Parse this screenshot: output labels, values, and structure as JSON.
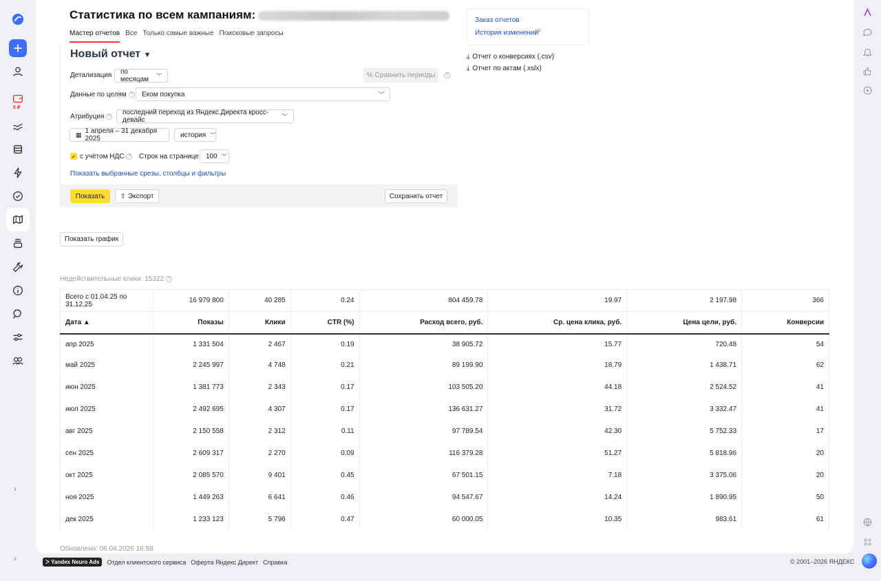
{
  "title": "Статистика по всем кампаниям:",
  "tabs": [
    "Мастер отчетов",
    "Все",
    "Только самые важные",
    "Поисковые запросы"
  ],
  "report": {
    "name": "Новый отчет",
    "detail_label": "Детализация",
    "detail_value": "по месяцам",
    "compare_label": "Сравнить периоды",
    "goals_label": "Данные по целям",
    "goals_value": "Еком покупка",
    "attribution_label": "Атрибуция",
    "attribution_value": "последний переход из Яндекс.Директа кросс-девайс",
    "date_range": "1 апреля – 31 декабря 2025",
    "history_value": "история",
    "vat_label": "с учётом НДС",
    "rows_label": "Строк на странице",
    "rows_value": "100",
    "filters_link": "Показать выбранные срезы, столбцы и фильтры",
    "show_button": "Показать",
    "export_button": "Экспорт",
    "save_button": "Сохранить отчет"
  },
  "side": {
    "order_reports": "Заказ отчетов",
    "change_history": "История изменений",
    "conversions_report": "Отчет о конверсиях (.csv)",
    "acts_report": "Отчет по актам (.xslx)"
  },
  "show_chart_button": "Показать график",
  "invalid_clicks": "Недействительные клики: 15322",
  "table": {
    "total": [
      "Всего с 01.04.25 по 31.12.25",
      "16 979 800",
      "40 285",
      "0.24",
      "804 459.78",
      "19.97",
      "2 197.98",
      "366"
    ],
    "columns": [
      "Дата ▲",
      "Показы",
      "Клики",
      "CTR (%)",
      "Расход всего, руб.",
      "Ср. цена клика, руб.",
      "Цена цели, руб.",
      "Конверсии"
    ],
    "rows": [
      [
        "апр 2025",
        "1 331 504",
        "2 467",
        "0.19",
        "38 905.72",
        "15.77",
        "720.48",
        "54"
      ],
      [
        "май 2025",
        "2 245 997",
        "4 748",
        "0.21",
        "89 199.90",
        "18.79",
        "1 438.71",
        "62"
      ],
      [
        "июн 2025",
        "1 381 773",
        "2 343",
        "0.17",
        "103 505.20",
        "44.18",
        "2 524.52",
        "41"
      ],
      [
        "июл 2025",
        "2 492 695",
        "4 307",
        "0.17",
        "136 631.27",
        "31.72",
        "3 332.47",
        "41"
      ],
      [
        "авг 2025",
        "2 150 558",
        "2 312",
        "0.11",
        "97 789.54",
        "42.30",
        "5 752.33",
        "17"
      ],
      [
        "сен 2025",
        "2 609 317",
        "2 270",
        "0.09",
        "116 379.28",
        "51.27",
        "5 818.96",
        "20"
      ],
      [
        "окт 2025",
        "2 085 570",
        "9 401",
        "0.45",
        "67 501.15",
        "7.18",
        "3 375.06",
        "20"
      ],
      [
        "ноя 2025",
        "1 449 263",
        "6 641",
        "0.46",
        "94 547.67",
        "14.24",
        "1 890.95",
        "50"
      ],
      [
        "дек 2025",
        "1 233 123",
        "5 796",
        "0.47",
        "60 000.05",
        "10.35",
        "983.61",
        "61"
      ]
    ]
  },
  "updated": "Обновлено: 06.04.2026 16:58",
  "footer": {
    "logo": "Yandex Neuro Ads",
    "links": [
      "Отдел клиентского сервиса",
      "Оферта Яндекс Директ",
      "Справка"
    ],
    "copyright": "© 2001–2026 ЯНДЕКС"
  },
  "rail": {
    "badge": "0 ₽"
  }
}
